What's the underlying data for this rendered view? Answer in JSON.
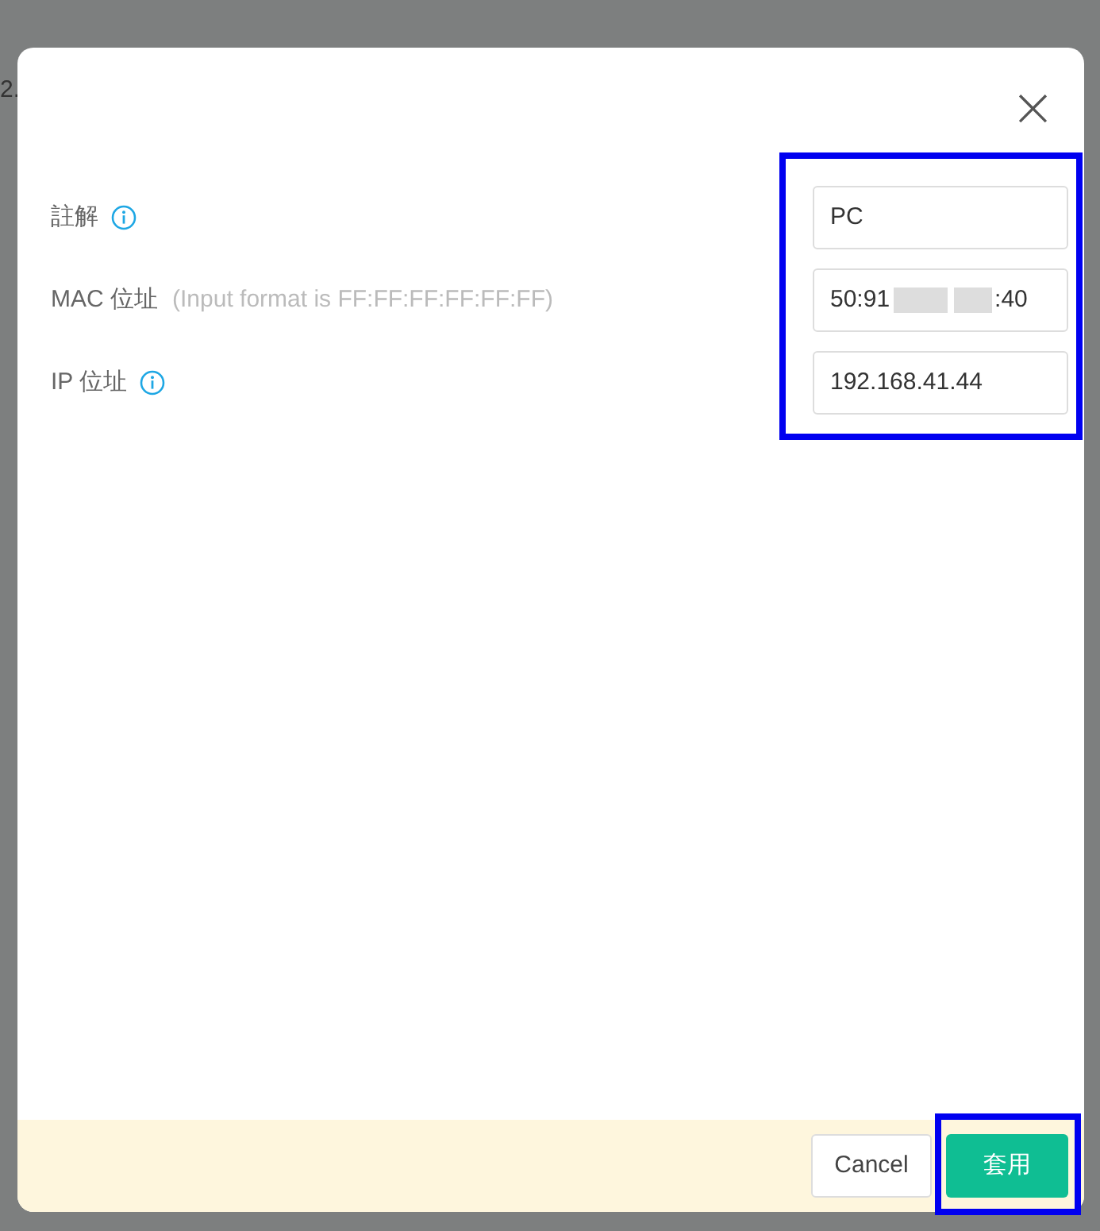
{
  "background": {
    "text": "2."
  },
  "dialog": {
    "close": "×",
    "fields": [
      {
        "kind": "text",
        "label": "註解",
        "info": true,
        "value": "PC"
      },
      {
        "kind": "redacted",
        "label": "MAC 位址",
        "info": false,
        "hint": "(Input format is FF:FF:FF:FF:FF:FF)",
        "value_parts": [
          "50:91",
          ":40"
        ]
      },
      {
        "kind": "text",
        "label": "IP 位址",
        "info": true,
        "value": "192.168.41.44"
      }
    ],
    "buttons": [
      {
        "label": "Cancel",
        "kind": "secondary"
      },
      {
        "label": "套用",
        "kind": "primary"
      }
    ]
  }
}
